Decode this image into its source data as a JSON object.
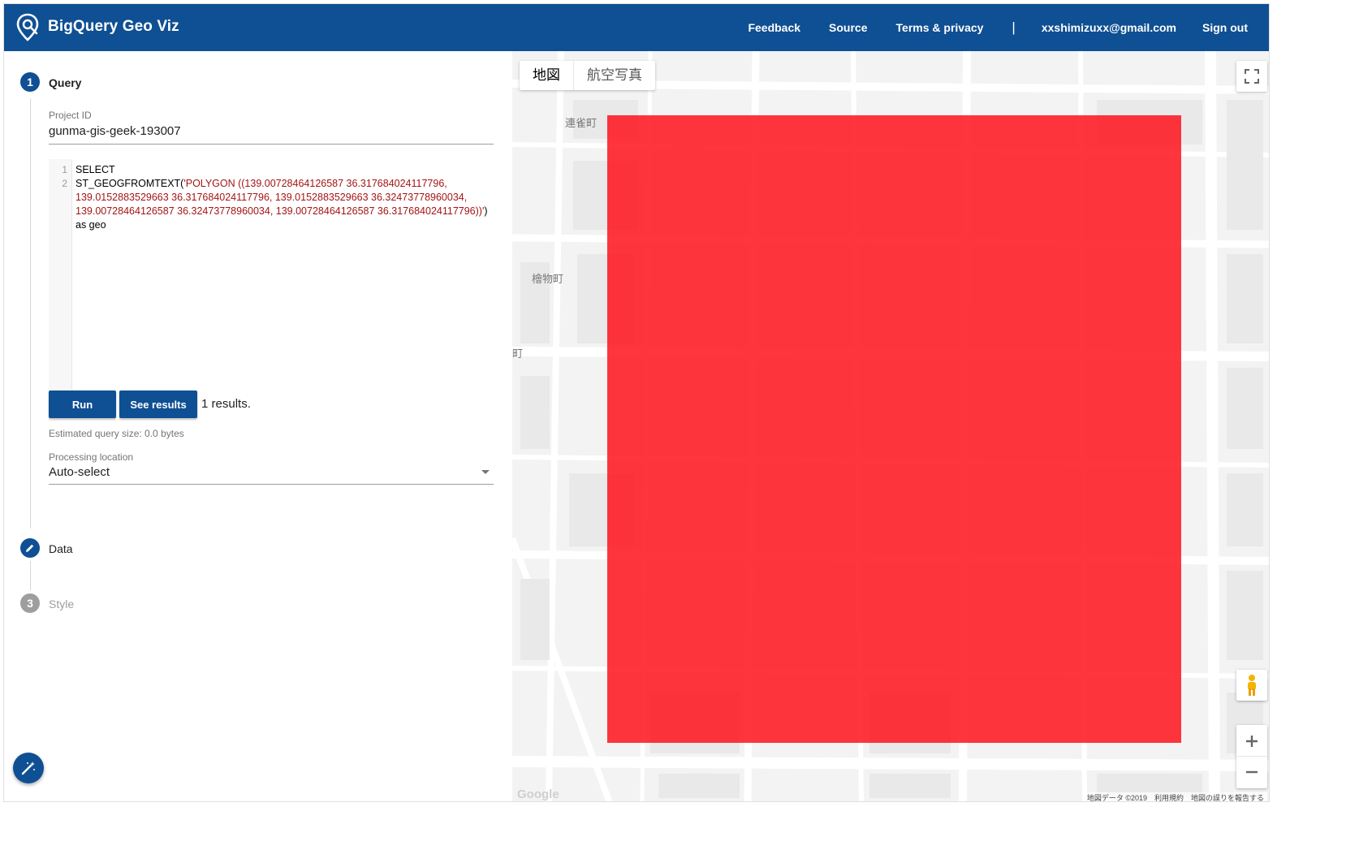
{
  "header": {
    "title": "BigQuery Geo Viz",
    "nav": {
      "feedback": "Feedback",
      "source": "Source",
      "terms": "Terms & privacy",
      "separator": "|",
      "email": "xxshimizuxx@gmail.com",
      "signout": "Sign out"
    },
    "colors": {
      "bar": "#0f4f93"
    }
  },
  "steps": {
    "query": {
      "number": "1",
      "label": "Query"
    },
    "data": {
      "label": "Data",
      "icon": "pencil-icon"
    },
    "style": {
      "number": "3",
      "label": "Style"
    }
  },
  "query": {
    "project_label": "Project ID",
    "project_id": "gunma-gis-geek-193007",
    "line_numbers": [
      "1",
      "2"
    ],
    "sql": {
      "line1": "SELECT",
      "line2_fn": "ST_GEOGFROMTEXT(",
      "line2_str": "'POLYGON ((139.00728464126587 36.317684024117796, 139.0152883529663 36.317684024117796, 139.0152883529663 36.32473778960034, 139.00728464126587 36.32473778960034, 139.00728464126587 36.317684024117796))'",
      "line2_tail": ") as geo"
    },
    "run_label": "Run",
    "see_results_label": "See results",
    "results_text": "1 results.",
    "estimate": "Estimated query size: 0.0 bytes",
    "location_label": "Processing location",
    "location_value": "Auto-select"
  },
  "map": {
    "type_map": "地図",
    "type_satellite": "航空写真",
    "place_labels": {
      "renjakucho": "連雀町",
      "hinokimonocho": "檜物町",
      "cho": "町"
    },
    "attribution": "地図データ ©2019　利用規約　地図の誤りを報告する",
    "google_text": "Google",
    "polygon_color": "#ff141e"
  }
}
